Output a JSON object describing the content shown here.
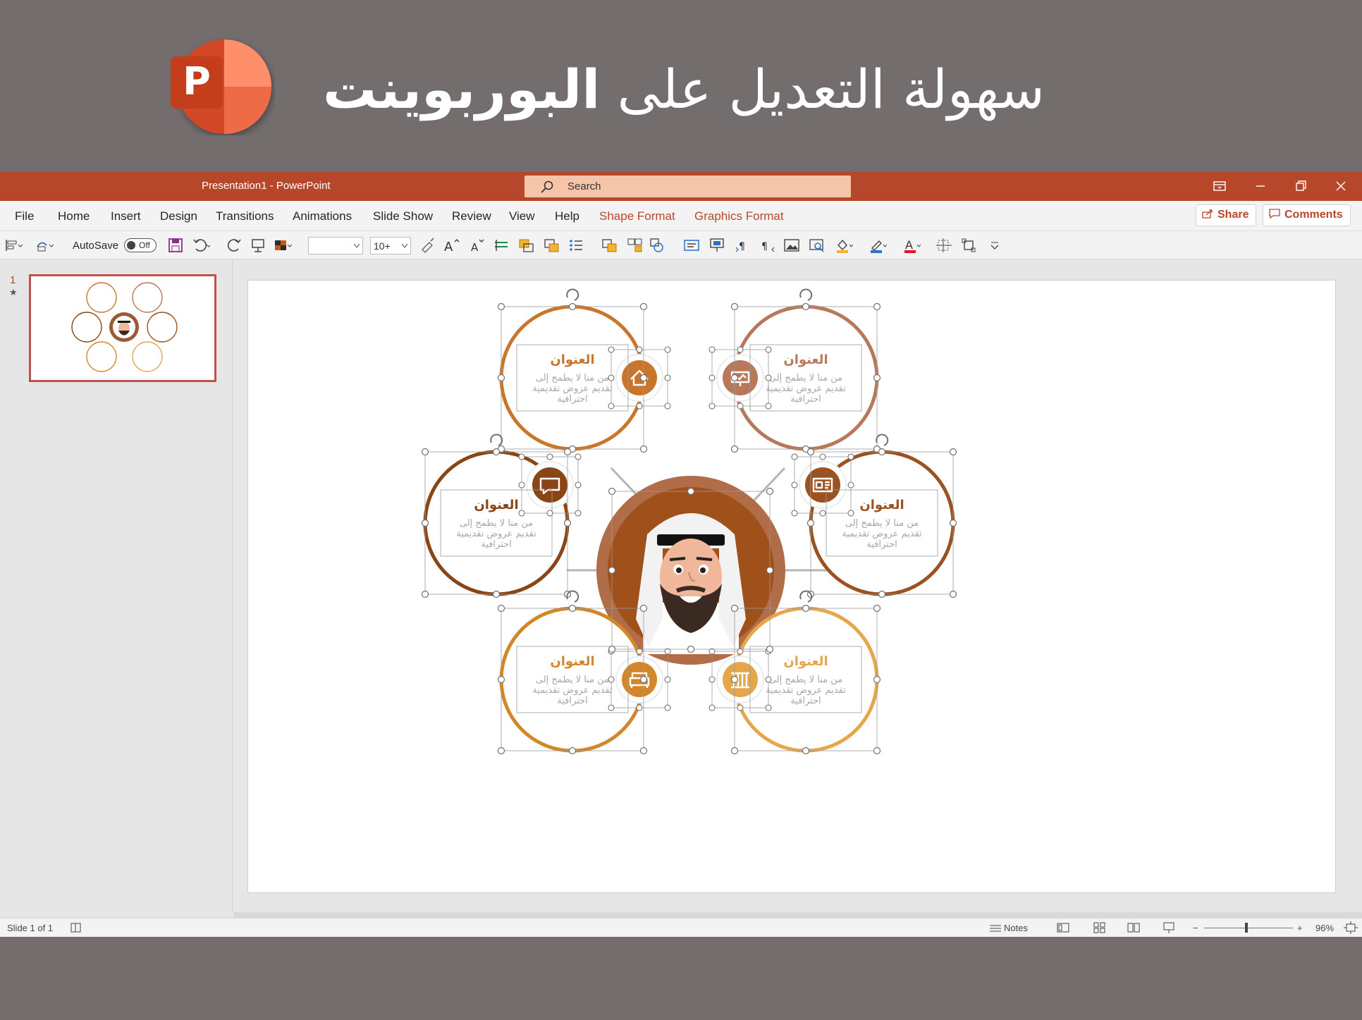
{
  "banner": {
    "headline_regular": "سهولة التعديل على",
    "headline_bold": "البوربوينت",
    "logo_letter": "P"
  },
  "window": {
    "title": "Presentation1  -  PowerPoint",
    "search_placeholder": "Search"
  },
  "menu": {
    "items": [
      "File",
      "Home",
      "Insert",
      "Design",
      "Transitions",
      "Animations",
      "Slide Show",
      "Review",
      "View",
      "Help"
    ],
    "context_tabs": [
      "Shape Format",
      "Graphics Format"
    ],
    "share_label": "Share",
    "comments_label": "Comments"
  },
  "toolbar": {
    "autosave_label": "AutoSave",
    "autosave_state": "Off",
    "font_size": "10+"
  },
  "thumbnails": {
    "slide_number": "1",
    "star": "★"
  },
  "slide": {
    "title_text": "العنوان",
    "body_line1": "من منا لا يطمح إلى",
    "body_line2": "تقديم عروض تقديمية",
    "body_line3": "احترافية",
    "circles": [
      {
        "pos": "top-left",
        "color": "#c9762d",
        "icon": "home-icon"
      },
      {
        "pos": "top-right",
        "color": "#b8795a",
        "icon": "presentation-icon"
      },
      {
        "pos": "middle-left",
        "color": "#8a4516",
        "icon": "chat-icon"
      },
      {
        "pos": "middle-right",
        "color": "#9a5220",
        "icon": "id-card-icon"
      },
      {
        "pos": "bottom-left",
        "color": "#d4862a",
        "icon": "sofa-icon"
      },
      {
        "pos": "bottom-right",
        "color": "#e6a64a",
        "icon": "pillars-icon"
      }
    ]
  },
  "status": {
    "slide_info": "Slide 1 of 1",
    "notes_label": "Notes",
    "zoom": "96%"
  },
  "colors": {
    "ribbon": "#b7472a",
    "search": "#f6c4a9",
    "banner": "#736d6d"
  }
}
